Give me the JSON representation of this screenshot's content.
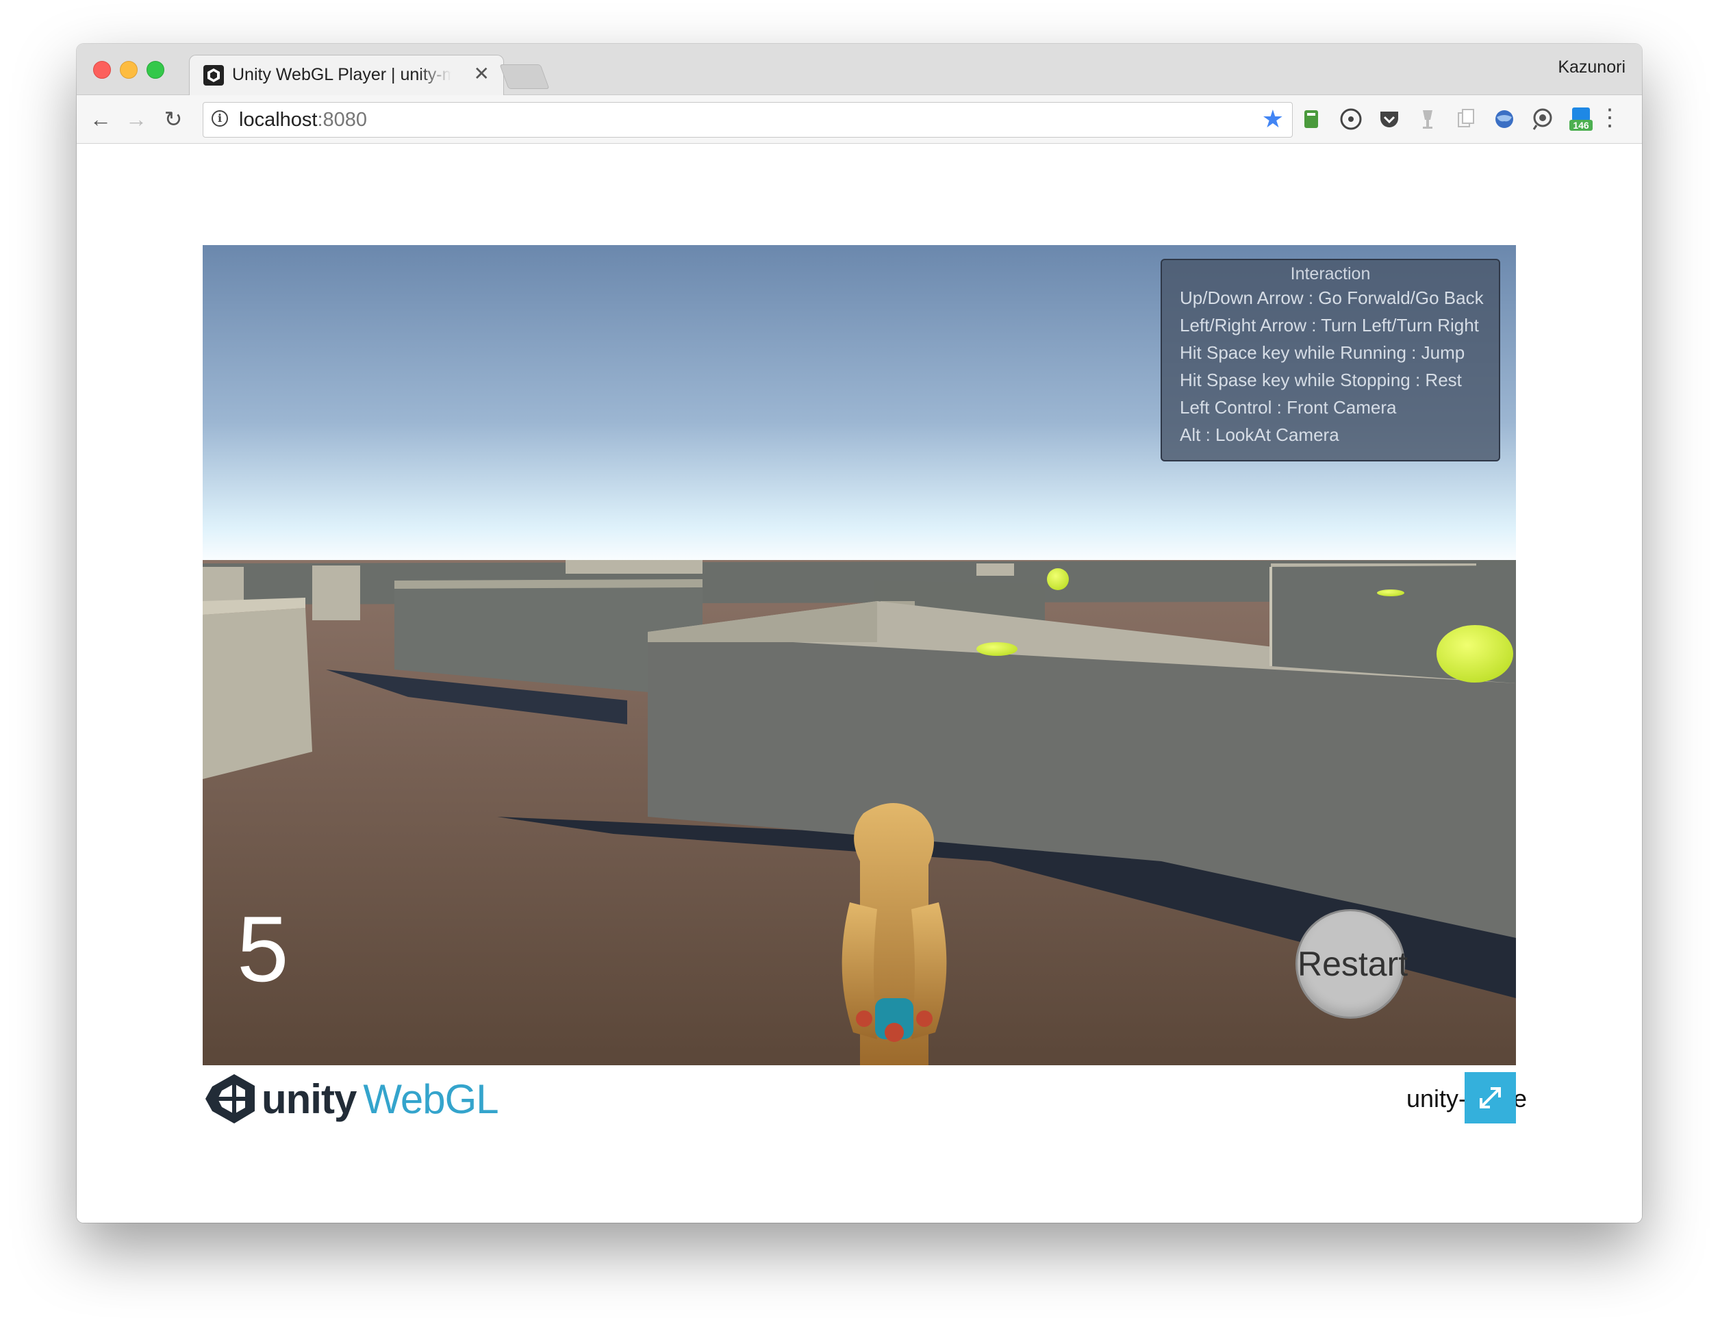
{
  "browser": {
    "tab_title": "Unity WebGL Player | unity-maze",
    "profile_name": "Kazunori",
    "url_host": "localhost",
    "url_port": ":8080",
    "extension_badge": "146",
    "icons": [
      "back-arrow-icon",
      "forward-arrow-icon",
      "reload-icon",
      "info-icon",
      "bookmark-star-icon",
      "menu-dots-icon"
    ]
  },
  "game": {
    "interaction_title": "Interaction",
    "interaction_lines": [
      "Up/Down Arrow : Go Forwald/Go Back",
      "Left/Right Arrow : Turn Left/Turn Right",
      "Hit Space key while Running : Jump",
      "Hit Spase key while Stopping : Rest",
      "Left Control : Front Camera",
      "Alt : LookAt Camera"
    ],
    "counter": "5",
    "restart_label": "Restart"
  },
  "footer": {
    "logo_unity": "unity",
    "logo_webgl": "WebGL",
    "build_title": "unity-maze"
  },
  "colors": {
    "accent": "#34b0dc",
    "sky_top": "#6b88ad",
    "ground": "#6b5547",
    "orb": "#d8f23c"
  }
}
